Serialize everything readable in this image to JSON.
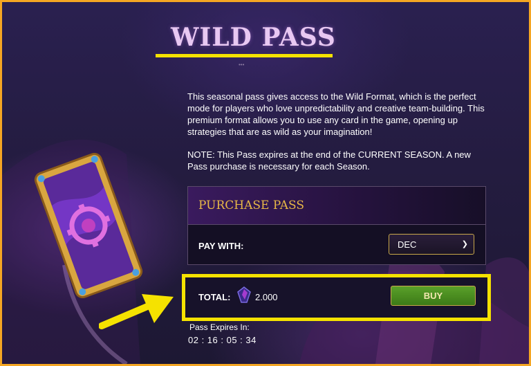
{
  "header": {
    "title": "WILD PASS"
  },
  "description": {
    "paragraph_1": "This seasonal pass gives access to the Wild Format, which is the perfect mode for players who love unpredictability and creative team-building. This premium format allows you to use any card in the game, opening up strategies that are as wild as your imagination!",
    "paragraph_2": "NOTE: This Pass expires at the end of the CURRENT SEASON. A new Pass purchase is necessary for each Season."
  },
  "purchase_panel": {
    "title": "PURCHASE PASS",
    "pay_with_label": "PAY WITH:",
    "currency_select": {
      "selected": "DEC"
    }
  },
  "total": {
    "label": "TOTAL:",
    "currency_icon": "gem-icon",
    "amount": "2.000",
    "buy_label": "BUY"
  },
  "expiry": {
    "label": "Pass Expires In:",
    "timer": "02 : 16 : 05 : 34"
  },
  "colors": {
    "frame_border": "#f5a623",
    "highlight": "#f5e200",
    "panel_title": "#e8b847",
    "buy_button": "#4a8e20",
    "title_text": "#e8c8f2"
  }
}
